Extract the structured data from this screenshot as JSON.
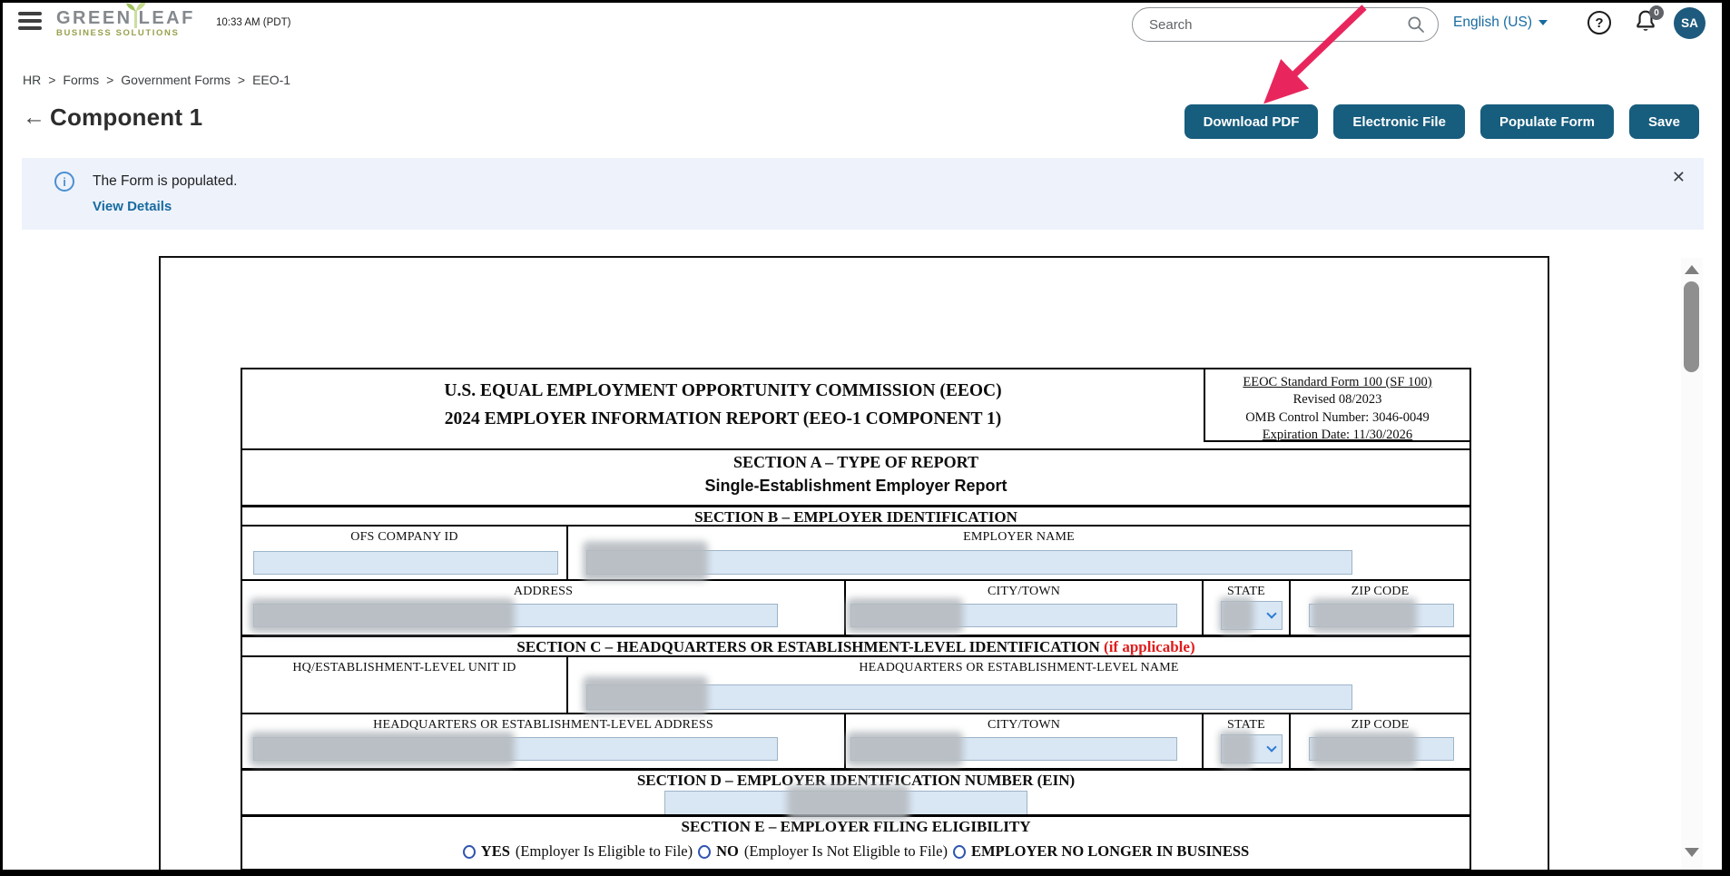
{
  "header": {
    "time": "10:33 AM (PDT)",
    "logo_top_left": "GREEN",
    "logo_top_right": "LEAF",
    "logo_bottom": "BUSINESS SOLUTIONS",
    "search_placeholder": "Search",
    "language_label": "English (US)",
    "help_glyph": "?",
    "badge_count": "0",
    "avatar_initials": "SA"
  },
  "breadcrumb": {
    "items": [
      "HR",
      "Forms",
      "Government Forms",
      "EEO-1"
    ],
    "separator": ">"
  },
  "toolbar": {
    "back_arrow": "←",
    "title": "Component 1",
    "download_pdf": "Download PDF",
    "electronic_file": "Electronic File",
    "populate_form": "Populate Form",
    "save": "Save"
  },
  "banner": {
    "info_glyph": "i",
    "message": "The Form is populated.",
    "link_label": "View Details",
    "close_glyph": "✕"
  },
  "form": {
    "header": {
      "title1": "U.S. EQUAL EMPLOYMENT OPPORTUNITY COMMISSION (EEOC)",
      "title2": "2024 EMPLOYER INFORMATION REPORT (EEO-1 COMPONENT 1)",
      "meta1": "EEOC Standard Form 100 (SF 100)",
      "meta2": "Revised 08/2023",
      "meta3": "OMB Control Number: 3046-0049",
      "meta4": "Expiration Date: 11/30/2026"
    },
    "section_a": {
      "title": "SECTION A – TYPE OF REPORT",
      "subtitle": "Single-Establishment Employer Report"
    },
    "section_b": {
      "title": "SECTION B – EMPLOYER IDENTIFICATION",
      "ofs_company_id": "OFS COMPANY ID",
      "employer_name": "EMPLOYER NAME",
      "address": "ADDRESS",
      "city": "CITY/TOWN",
      "state": "STATE",
      "zip": "ZIP CODE"
    },
    "section_c": {
      "title": "SECTION C – HEADQUARTERS OR ESTABLISHMENT-LEVEL IDENTIFICATION ",
      "title_note": "(if applicable)",
      "unit_id": "HQ/ESTABLISHMENT-LEVEL UNIT ID",
      "name": "HEADQUARTERS OR ESTABLISHMENT-LEVEL NAME",
      "address": "HEADQUARTERS OR ESTABLISHMENT-LEVEL ADDRESS",
      "city": "CITY/TOWN",
      "state": "STATE",
      "zip": "ZIP CODE"
    },
    "section_d": {
      "title": "SECTION D – EMPLOYER IDENTIFICATION NUMBER (EIN)"
    },
    "section_e": {
      "title": "SECTION E – EMPLOYER FILING ELIGIBILITY",
      "opt1_bold": "YES",
      "opt1_rest": "(Employer Is Eligible to File)",
      "opt2_bold": "NO",
      "opt2_rest": "(Employer Is Not Eligible to File)",
      "opt3_bold": "EMPLOYER NO LONGER IN BUSINESS"
    }
  },
  "colors": {
    "primary_button": "#175d7e",
    "link_blue": "#186ba0",
    "banner_bg": "#eef2fb",
    "field_fill": "#d9e6f4",
    "annotation_arrow": "#e8265d"
  }
}
